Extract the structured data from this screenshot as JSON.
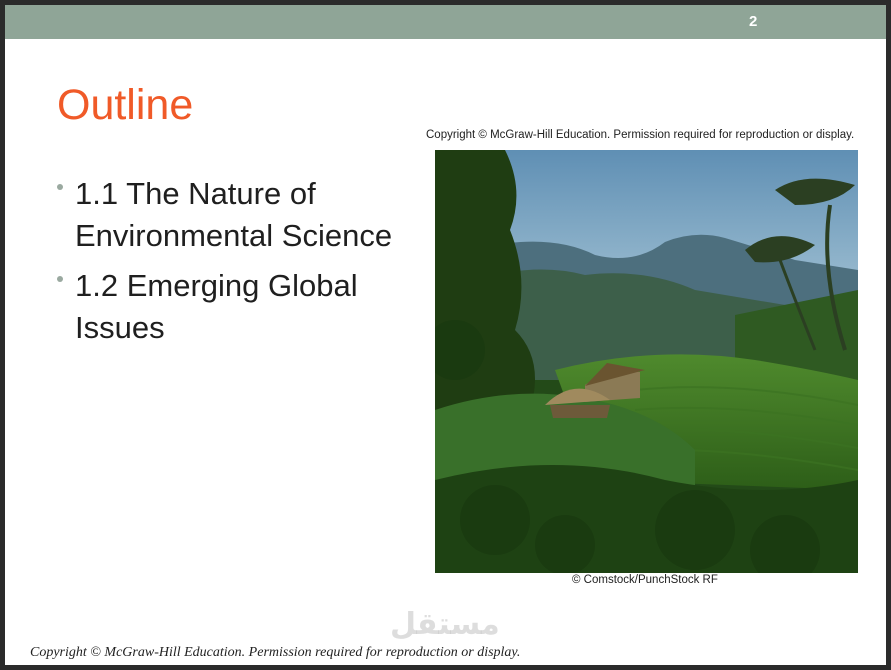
{
  "slide": {
    "page_number": "2",
    "title": "Outline",
    "bullets": [
      {
        "text": "1.1 The Nature of\nEnvironmental Science"
      },
      {
        "text": "1.2 Emerging Global\nIssues"
      }
    ],
    "image_copyright": "Copyright © McGraw-Hill Education. Permission required for reproduction or display.",
    "image_credit": "© Comstock/PunchStock RF",
    "footer": "Copyright © McGraw-Hill Education.  Permission required for reproduction or display.",
    "watermark": "مستقل"
  },
  "colors": {
    "title": "#f05a28",
    "topbar": "#8fa597",
    "bullet_dot": "#9aa9a0"
  }
}
